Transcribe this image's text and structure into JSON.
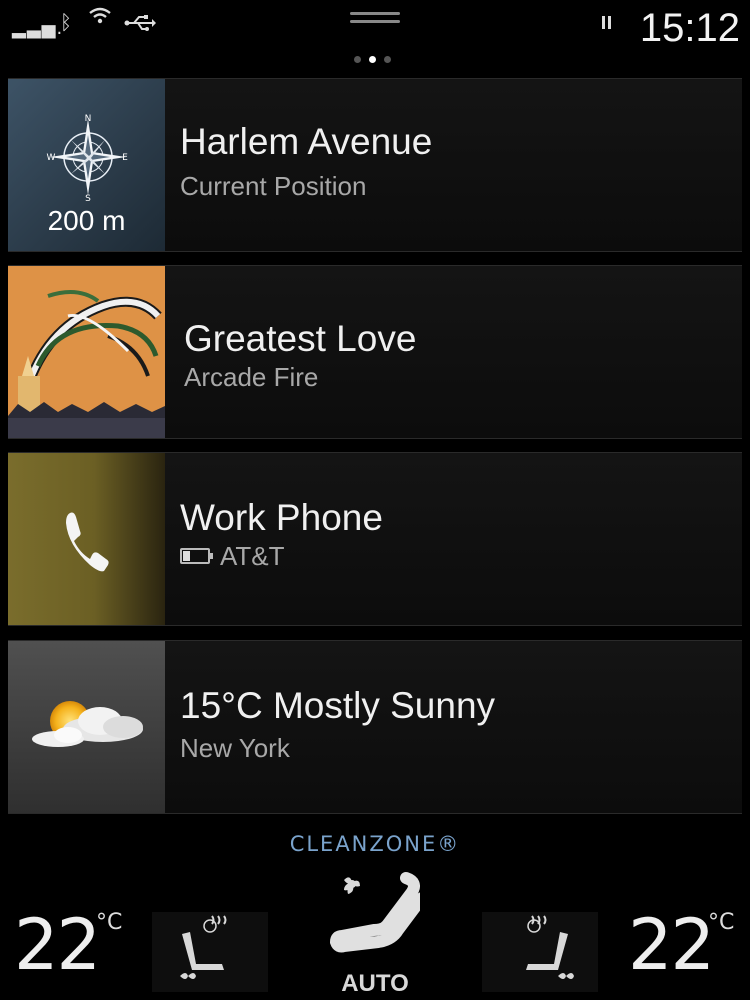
{
  "status": {
    "clock": "15:12",
    "page_count": 3,
    "active_page": 2
  },
  "cards": [
    {
      "title": "Harlem Avenue",
      "subtitle": "Current Position",
      "distance": "200 m",
      "compass": {
        "n": "N",
        "s": "S",
        "e": "E",
        "w": "W"
      }
    },
    {
      "title": "Greatest Love",
      "subtitle": "Arcade Fire"
    },
    {
      "title": "Work Phone",
      "subtitle": "AT&T"
    },
    {
      "title": "15°C Mostly Sunny",
      "subtitle": "New York"
    }
  ],
  "climate": {
    "cleanzone": "CLEANZONE®",
    "left_temp": "22",
    "right_temp": "22",
    "unit": "°C",
    "mode": "AUTO"
  },
  "colors": {
    "accent_blue": "#7aa3cc",
    "background": "#000000"
  }
}
